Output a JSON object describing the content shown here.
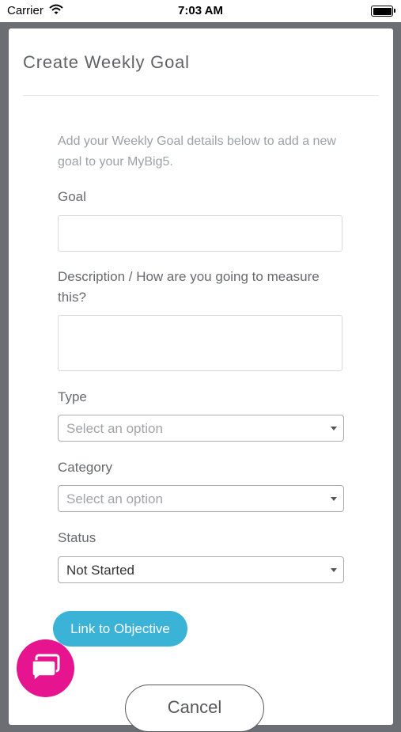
{
  "status_bar": {
    "carrier": "Carrier",
    "time": "7:03 AM"
  },
  "form": {
    "title": "Create Weekly Goal",
    "intro": "Add your Weekly Goal details below to add a new goal to your MyBig5.",
    "goal": {
      "label": "Goal",
      "value": ""
    },
    "description": {
      "label": "Description / How are you going to measure this?",
      "value": ""
    },
    "type": {
      "label": "Type",
      "placeholder": "Select an option"
    },
    "category": {
      "label": "Category",
      "placeholder": "Select an option"
    },
    "status": {
      "label": "Status",
      "value": "Not Started"
    },
    "link_button": "Link to Objective",
    "cancel_button": "Cancel"
  },
  "colors": {
    "accent": "#3bb3d6",
    "chat_fab": "#e6158f",
    "backdrop": "#6b6e73"
  },
  "icons": {
    "wifi": "wifi-icon",
    "battery": "battery-icon",
    "chat": "chat-bubble-icon",
    "dropdown": "chevron-down-icon"
  }
}
